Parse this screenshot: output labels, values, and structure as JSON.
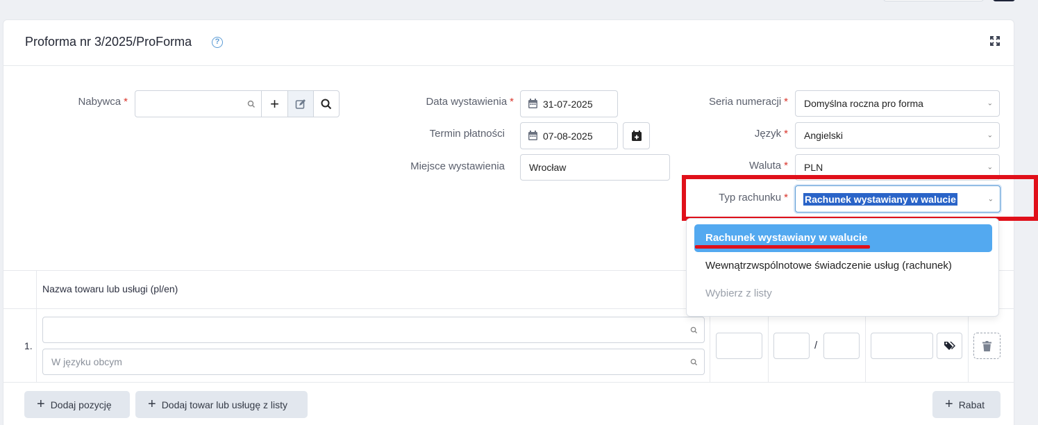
{
  "header": {
    "title": "Proforma nr 3/2025/ProForma"
  },
  "buyer": {
    "label": "Nabywca",
    "value": ""
  },
  "issue_date": {
    "label": "Data wystawienia",
    "value": "31-07-2025"
  },
  "payment_term": {
    "label": "Termin płatności",
    "value": "07-08-2025"
  },
  "place": {
    "label": "Miejsce wystawienia",
    "value": "Wrocław"
  },
  "series": {
    "label": "Seria numeracji",
    "value": "Domyślna roczna pro forma"
  },
  "language": {
    "label": "Język",
    "value": "Angielski"
  },
  "currency": {
    "label": "Waluta",
    "value": "PLN"
  },
  "account_type": {
    "label": "Typ rachunku",
    "value": "Rachunek wystawiany w walucie",
    "options": [
      "Rachunek wystawiany w walucie",
      "Wewnątrzwspólnotowe świadczenie usług (rachunek)",
      "Wybierz z listy"
    ]
  },
  "table": {
    "header_name": "Nazwa towaru lub usługi (pl/en)",
    "row_number": "1.",
    "foreign_placeholder": "W języku obcym",
    "slash": "/"
  },
  "footer": {
    "add_position": "Dodaj pozycję",
    "add_from_list": "Dodaj towar lub usługę z listy",
    "discount": "Rabat"
  },
  "colors": {
    "highlight": "#e0101a",
    "selected_option": "#53a9f0",
    "required": "#d9342b"
  }
}
